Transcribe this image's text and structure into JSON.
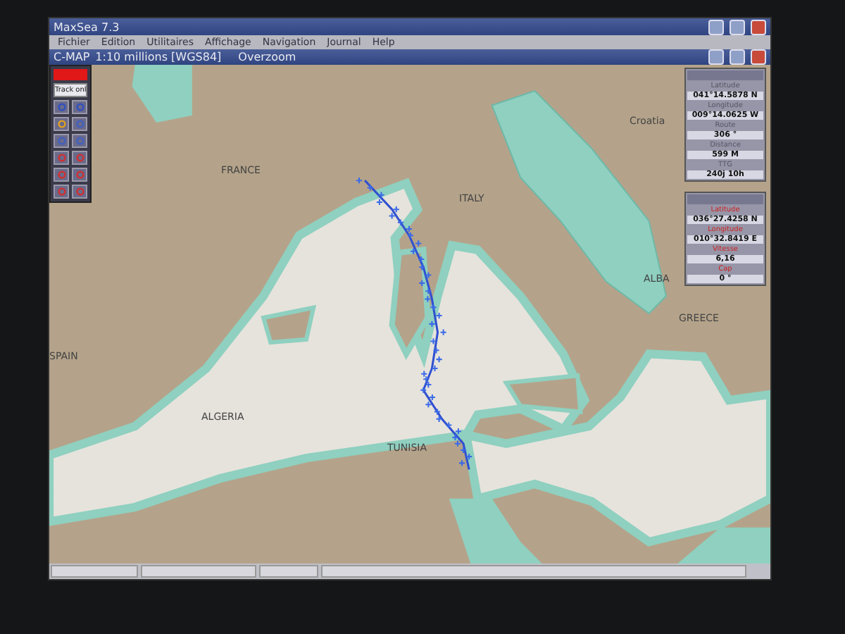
{
  "app": {
    "title": "MaxSea 7.3"
  },
  "menu": [
    "Fichier",
    "Edition",
    "Utilitaires",
    "Affichage",
    "Navigation",
    "Journal",
    "Help"
  ],
  "chart_window": {
    "source": "C-MAP",
    "title": "1:10 millions [WGS84]",
    "mode": "Overzoom"
  },
  "toolbar": {
    "label": "Track onl"
  },
  "map_labels": [
    "FRANCE",
    "ITALY",
    "Croatia",
    "ALBA",
    "GREECE",
    "SPAIN",
    "ALGERIA",
    "TUNISIA"
  ],
  "panels": [
    {
      "color": "#555566",
      "fields": [
        {
          "label": "Latitude",
          "value": "041°14.5878 N"
        },
        {
          "label": "Longitude",
          "value": "009°14.0625 W"
        },
        {
          "label": "Route",
          "value": "306 °"
        },
        {
          "label": "Distance",
          "value": "599 M"
        },
        {
          "label": "TTG",
          "value": "240j 10h"
        }
      ]
    },
    {
      "color": "#cc2222",
      "fields": [
        {
          "label": "Latitude",
          "value": "036°27.4258 N"
        },
        {
          "label": "Longitude",
          "value": "010°32.8419 E"
        },
        {
          "label": "Vitesse",
          "value": "6,16"
        },
        {
          "label": "Cap",
          "value": "0 °"
        }
      ]
    }
  ]
}
